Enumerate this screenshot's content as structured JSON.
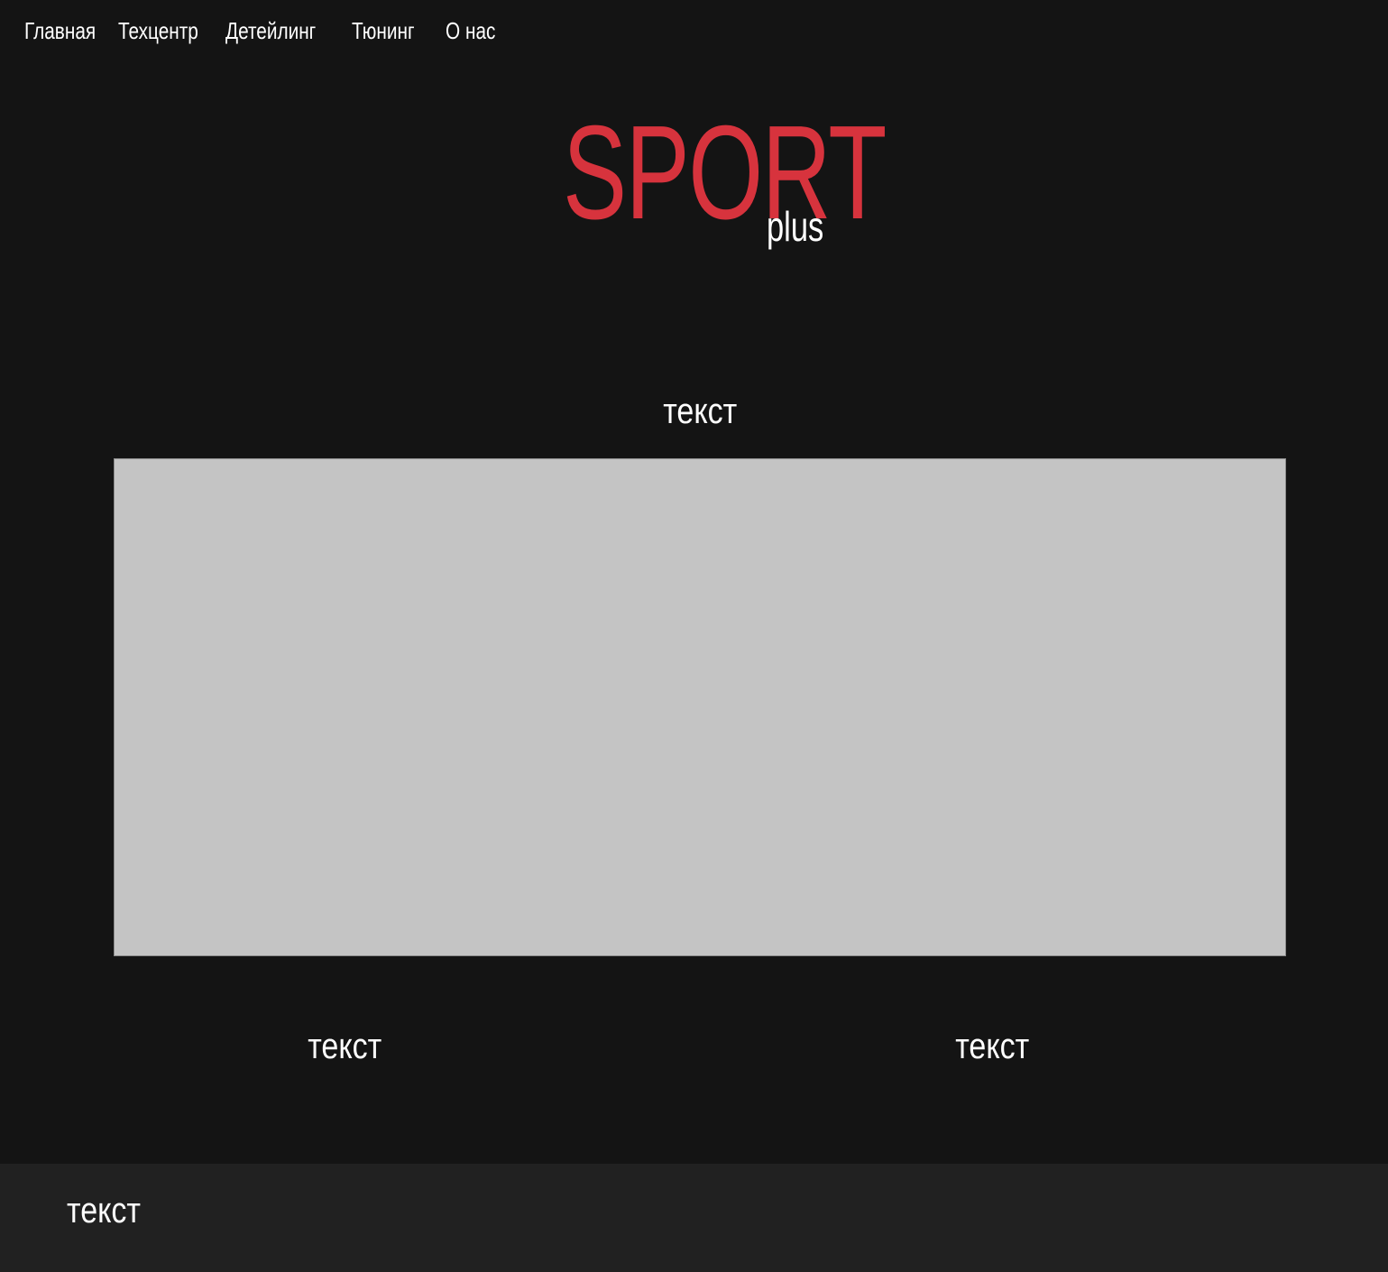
{
  "nav": {
    "items": [
      {
        "label": "Главная"
      },
      {
        "label": "Техцентр"
      },
      {
        "label": "Детейлинг"
      },
      {
        "label": "Тюнинг"
      },
      {
        "label": "О нас"
      }
    ]
  },
  "logo": {
    "main": "SPORT",
    "sub": "plus",
    "main_color": "#d7333d",
    "sub_color": "#ffffff"
  },
  "main": {
    "heading": "текст",
    "placeholder_color": "#c4c4c4",
    "columns": [
      {
        "text": "текст"
      },
      {
        "text": "текст"
      }
    ]
  },
  "footer": {
    "text": "текст",
    "background": "#212121"
  },
  "page": {
    "background": "#141414"
  }
}
